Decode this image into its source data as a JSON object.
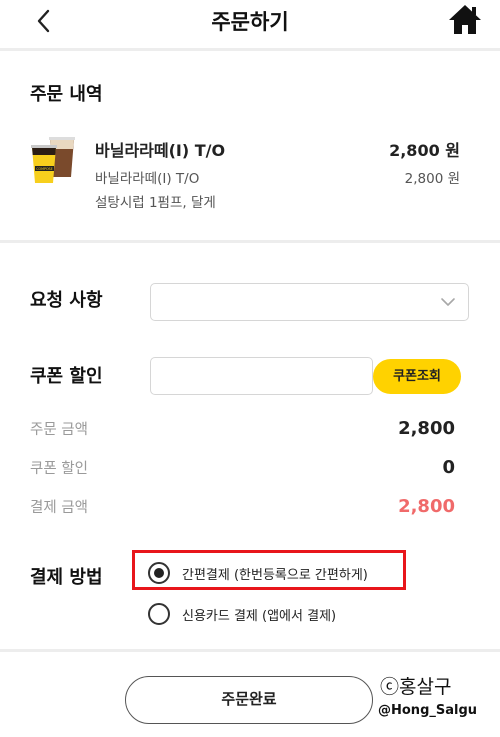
{
  "header": {
    "title": "주문하기",
    "back_icon": "chevron-left-icon",
    "home_icon": "home-icon"
  },
  "order": {
    "section_title": "주문 내역",
    "item": {
      "name": "바닐라라떼(I) T/O",
      "price": "2,800 원",
      "option_name": "바닐라라떼(I) T/O",
      "option_price": "2,800 원",
      "option_detail": "설탕시럽 1펌프, 달게",
      "cup_brand": "COMPOSE"
    }
  },
  "request": {
    "label": "요청 사항",
    "select_value": ""
  },
  "coupon": {
    "label": "쿠폰 할인",
    "input_value": "",
    "button_label": "쿠폰조회"
  },
  "summary": {
    "order_amount_label": "주문 금액",
    "order_amount": "2,800",
    "coupon_discount_label": "쿠폰 할인",
    "coupon_discount": "0",
    "payment_amount_label": "결제 금액",
    "payment_amount": "2,800"
  },
  "payment": {
    "label": "결제 방법",
    "options": [
      {
        "label": "간편결제 (한번등록으로 간편하게)",
        "selected": true
      },
      {
        "label": "신용카드 결제 (앱에서 결제)",
        "selected": false
      }
    ]
  },
  "submit": {
    "label": "주문완료"
  },
  "watermark": {
    "line1": "ⓒ홍살구",
    "line2": "@Hong_Salgu"
  },
  "colors": {
    "accent_yellow": "#ffd200",
    "price_red": "#f06a6a",
    "highlight_red": "#e8161b"
  }
}
